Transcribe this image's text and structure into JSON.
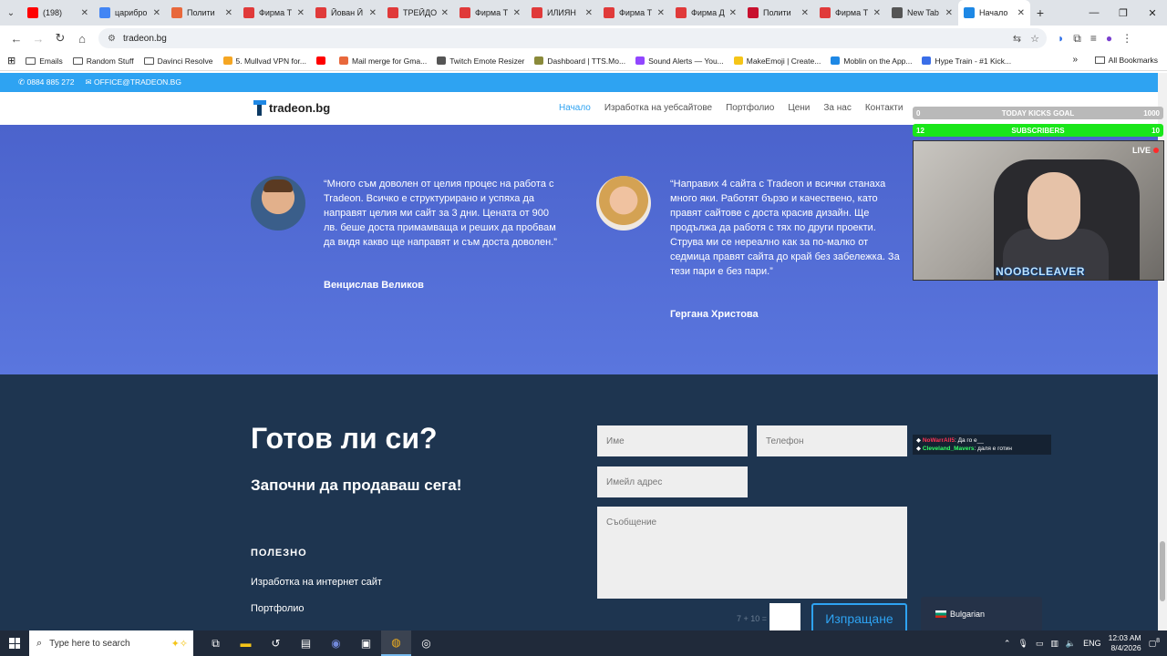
{
  "browser": {
    "tabs": [
      {
        "label": "(198)",
        "icon": "youtube-icon",
        "color": "#ff0000"
      },
      {
        "label": "царибро",
        "icon": "google-icon",
        "color": "#4285f4"
      },
      {
        "label": "Полити",
        "icon": "site-icon",
        "color": "#e8683c"
      },
      {
        "label": "Фирма Т",
        "icon": "p-icon",
        "color": "#e03a3a"
      },
      {
        "label": "Йован Й",
        "icon": "p-icon",
        "color": "#e03a3a"
      },
      {
        "label": "ТРЕЙДО",
        "icon": "p-icon",
        "color": "#e03a3a"
      },
      {
        "label": "Фирма Т",
        "icon": "p-icon",
        "color": "#e03a3a"
      },
      {
        "label": "ИЛИЯН",
        "icon": "p-icon",
        "color": "#e03a3a"
      },
      {
        "label": "Фирма Т",
        "icon": "p-icon",
        "color": "#e03a3a"
      },
      {
        "label": "Фирма Д",
        "icon": "p-icon",
        "color": "#e03a3a"
      },
      {
        "label": "Полити",
        "icon": "n-icon",
        "color": "#c8102e"
      },
      {
        "label": "Фирма Т",
        "icon": "p-icon",
        "color": "#e03a3a"
      },
      {
        "label": "New Tab",
        "icon": "chrome-icon",
        "color": "#555555"
      },
      {
        "label": "Начало",
        "icon": "tradeon-icon",
        "color": "#1e88e5"
      }
    ],
    "url": "tradeon.bg",
    "bookmarks": [
      {
        "label": "Emails",
        "type": "folder"
      },
      {
        "label": "Random Stuff",
        "type": "folder"
      },
      {
        "label": "Davinci Resolve",
        "type": "folder"
      },
      {
        "label": "5. Mullvad VPN for...",
        "type": "link",
        "color": "#f5a623"
      },
      {
        "label": "",
        "type": "link",
        "color": "#ff0000"
      },
      {
        "label": "Mail merge for Gma...",
        "type": "link",
        "color": "#e8683c"
      },
      {
        "label": "Twitch Emote Resizer",
        "type": "link",
        "color": "#555555"
      },
      {
        "label": "Dashboard | TTS.Mo...",
        "type": "link",
        "color": "#8a8a3a"
      },
      {
        "label": "Sound Alerts — You...",
        "type": "link",
        "color": "#9146ff"
      },
      {
        "label": "MakeEmoji | Create...",
        "type": "link",
        "color": "#f5c518"
      },
      {
        "label": "Moblin on the App...",
        "type": "link",
        "color": "#1e88e5"
      },
      {
        "label": "Hype Train - #1 Kick...",
        "type": "link",
        "color": "#3a6ee8"
      }
    ],
    "all_bookmarks": "All Bookmarks"
  },
  "site": {
    "phone": "0884 885 272",
    "email": "OFFICE@TRADEON.BG",
    "logo": "tradeon.bg",
    "menu": [
      "Начало",
      "Изработка на уебсайтове",
      "Портфолио",
      "Цени",
      "За нас",
      "Контакти"
    ],
    "accent": "#2ea3f2"
  },
  "testimonials": [
    {
      "quote": "“Много съм доволен от целия процес на работа с Tradeon. Всичко е структурирано и успяха да направят целия ми сайт за 3 дни. Цената от 900 лв. беше доста примамваща и реших да пробвам да видя какво ще направят и съм доста доволен.”",
      "author": "Венцислав Великов"
    },
    {
      "quote": "“Направих 4 сайта с Tradeon и всички станаха много яки. Работят бързо и качествено, като правят сайтове с доста красив дизайн. Ще продължа да работя с тях по други проекти. Струва ми се нереално как за по-малко от седмица правят сайта до край без забележка. За тези пари е без пари.”",
      "author": "Гергана Христова"
    }
  ],
  "footer": {
    "title": "Готов ли си?",
    "subtitle": "Започни да продаваш сега!",
    "useful_heading": "ПОЛЕЗНО",
    "links": [
      "Изработка на интернет сайт",
      "Портфолио"
    ],
    "form": {
      "name_placeholder": "Име",
      "phone_placeholder": "Телефон",
      "email_placeholder": "Имейл адрес",
      "message_placeholder": "Съобщение",
      "captcha": "7 + 10 =",
      "send": "Изпращане"
    }
  },
  "overlay": {
    "goal1": {
      "left": "0",
      "label": "TODAY KICKS GOAL",
      "right": "1000"
    },
    "goal2": {
      "left": "12",
      "label": "SUBSCRIBERS",
      "right": "10"
    },
    "live": "LIVE",
    "brand": "NOOBCLEAVER",
    "chat": [
      {
        "user": "NoWarrAll5",
        "msg": ": Да го е__"
      },
      {
        "user": "Cleveland_Mavers",
        "msg": ": даля е готин"
      }
    ],
    "language": "Bulgarian"
  },
  "taskbar": {
    "search_placeholder": "Type here to search",
    "lang": "ENG",
    "time": "12:03 AM",
    "date": "8/4/2026",
    "notifications": "8"
  }
}
